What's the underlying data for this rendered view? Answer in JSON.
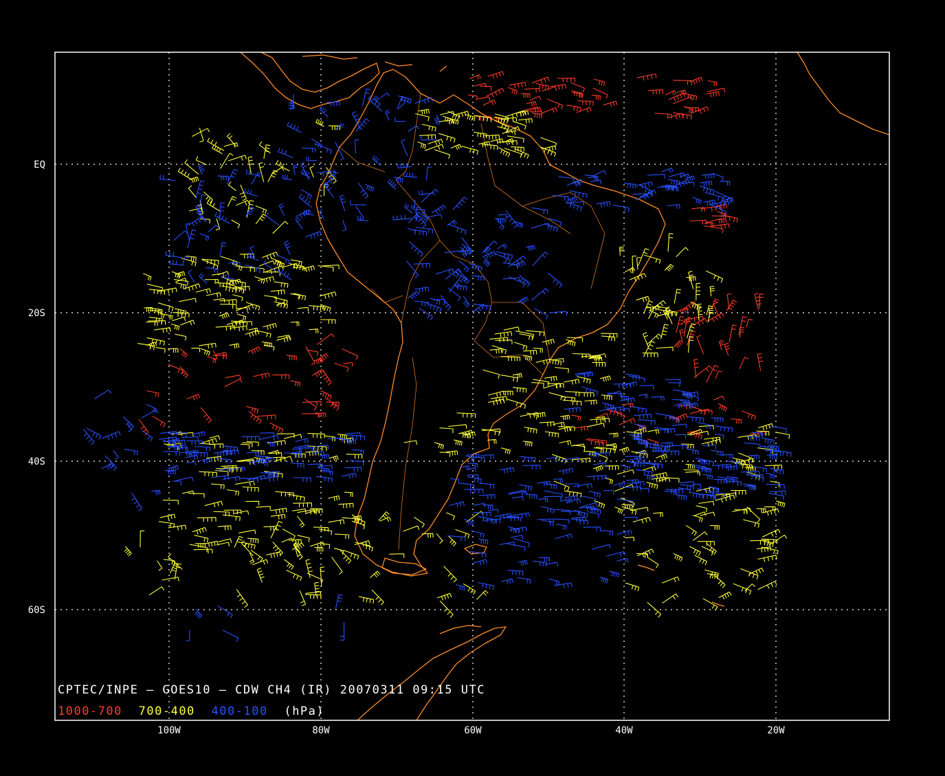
{
  "map": {
    "title": "CPTEC/INPE — GOES10 — CDW CH4 (IR) 20070311 09:15 UTC",
    "legend": {
      "low": {
        "label": "1000-700",
        "color": "#ff3c28"
      },
      "mid": {
        "label": "700-400",
        "color": "#ffff3c"
      },
      "high": {
        "label": "400-100",
        "color": "#2850ff"
      },
      "unit": "(hPa)"
    },
    "colors": {
      "background": "#000000",
      "frame": "#ffffff",
      "coast": "#ff8c28",
      "grid": "#ffffff"
    },
    "lat_labels": [
      "EQ",
      "20S",
      "40S",
      "60S"
    ],
    "lon_labels": [
      "100W",
      "80W",
      "60W",
      "40W",
      "20W"
    ]
  }
}
